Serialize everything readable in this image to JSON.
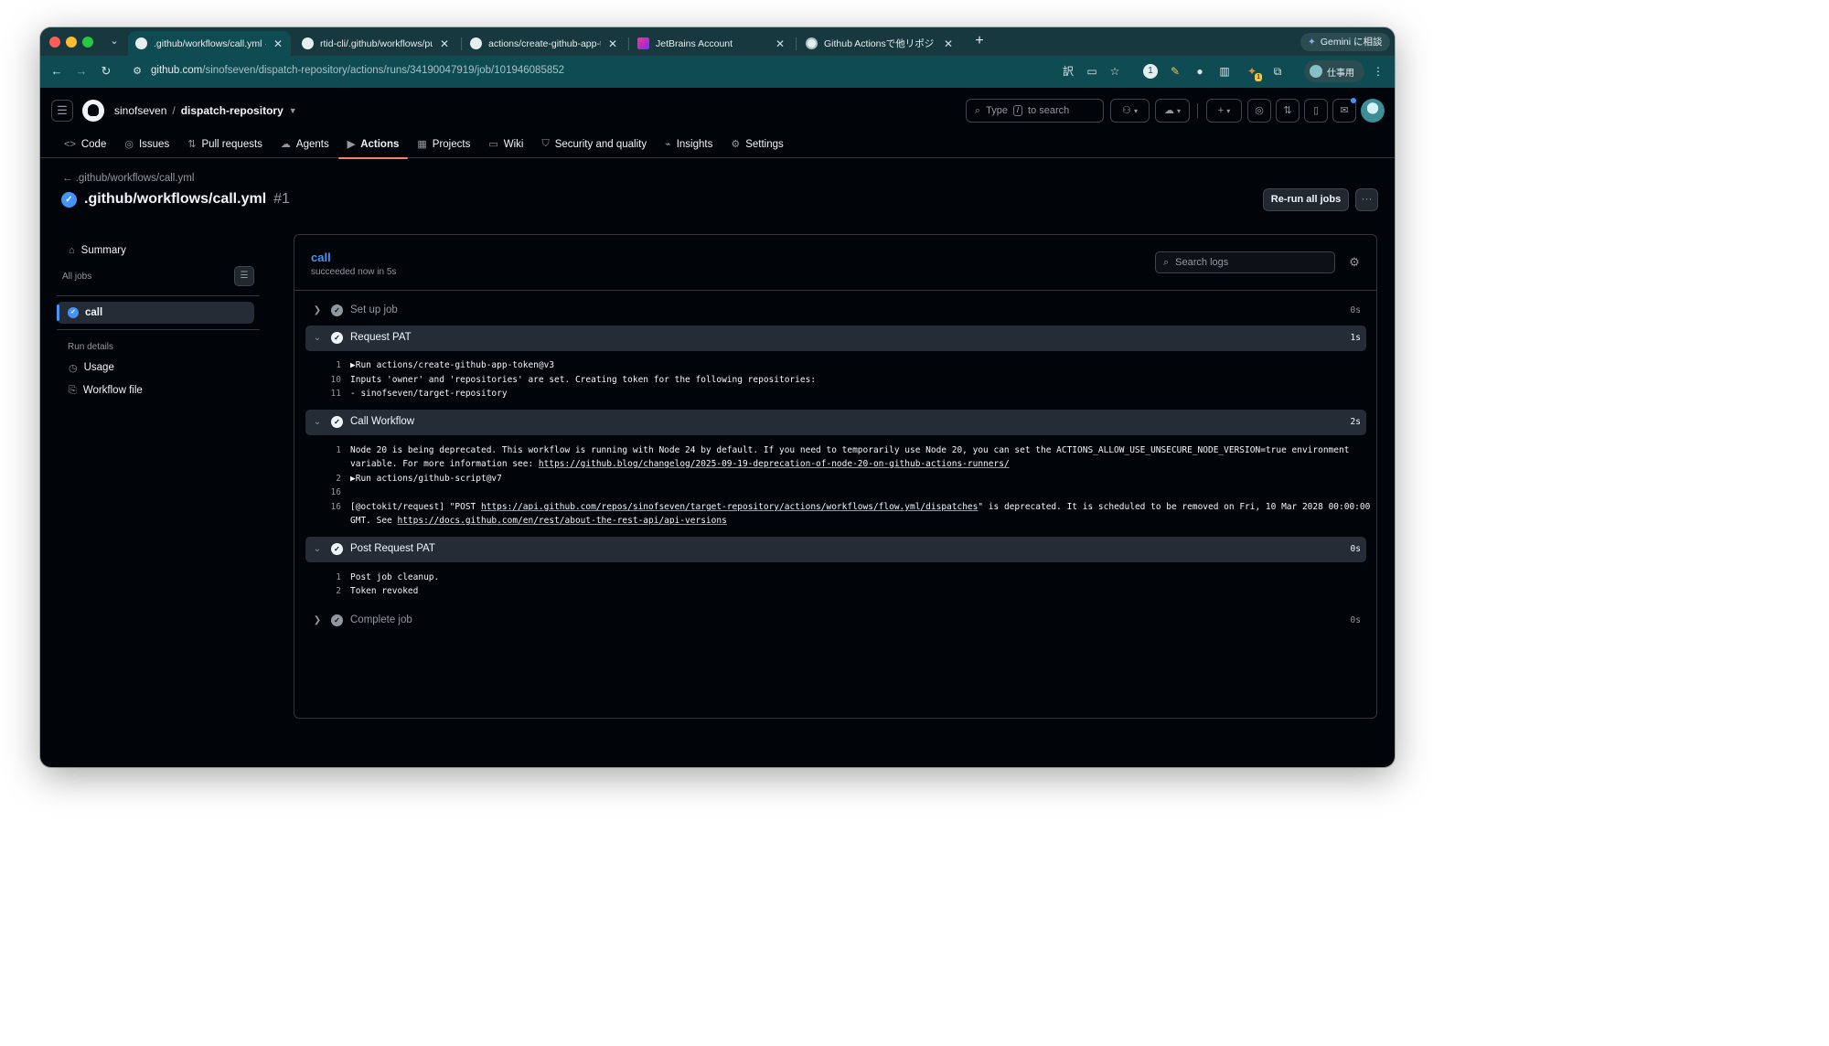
{
  "browser": {
    "tabs": [
      {
        "title": ".github/workflows/call.yml · si",
        "favicon": "github-icon",
        "active": true
      },
      {
        "title": "rtid-cli/.github/workflows/pub",
        "favicon": "github-icon",
        "active": false
      },
      {
        "title": "actions/create-github-app-to",
        "favicon": "github-icon",
        "active": false
      },
      {
        "title": "JetBrains Account",
        "favicon": "jetbrains-icon",
        "active": false
      },
      {
        "title": "Github Actionsで他リポジトリ",
        "favicon": "globe-icon",
        "active": false
      }
    ],
    "new_tab_label": "+",
    "gemini_label": "Gemini に相談",
    "url_host": "github.com",
    "url_path": "/sinofseven/dispatch-repository/actions/runs/34190047919/job/101946085852",
    "profile_label": "仕事用",
    "extension_badge": "1"
  },
  "header": {
    "owner": "sinofseven",
    "separator": "/",
    "repo": "dispatch-repository",
    "search_prefix": "Type",
    "search_key": "/",
    "search_suffix": "to search",
    "nav": [
      {
        "label": "Code",
        "icon": "code-icon"
      },
      {
        "label": "Issues",
        "icon": "issue-icon"
      },
      {
        "label": "Pull requests",
        "icon": "pull-request-icon"
      },
      {
        "label": "Agents",
        "icon": "agent-icon"
      },
      {
        "label": "Actions",
        "icon": "play-icon",
        "selected": true
      },
      {
        "label": "Projects",
        "icon": "table-icon"
      },
      {
        "label": "Wiki",
        "icon": "book-icon"
      },
      {
        "label": "Security and quality",
        "icon": "shield-icon"
      },
      {
        "label": "Insights",
        "icon": "graph-icon"
      },
      {
        "label": "Settings",
        "icon": "gear-icon"
      }
    ]
  },
  "run": {
    "back_link": ".github/workflows/call.yml",
    "title": ".github/workflows/call.yml",
    "number": "#1",
    "rerun_label": "Re-run all jobs",
    "more_label": "···"
  },
  "sidebar": {
    "summary_label": "Summary",
    "all_jobs_label": "All jobs",
    "job_label": "call",
    "run_details_label": "Run details",
    "usage_label": "Usage",
    "workflow_file_label": "Workflow file"
  },
  "log": {
    "job_name": "call",
    "status": "succeeded now in 5s",
    "search_placeholder": "Search logs",
    "steps": [
      {
        "name": "Set up job",
        "duration": "0s",
        "open": false,
        "lines": []
      },
      {
        "name": "Request PAT",
        "duration": "1s",
        "open": true,
        "lines": [
          {
            "n": "1",
            "text": "▶Run actions/create-github-app-token@v3"
          },
          {
            "n": "10",
            "text": "Inputs 'owner' and 'repositories' are set. Creating token for the following repositories:"
          },
          {
            "n": "11",
            "text": "- sinofseven/target-repository"
          }
        ]
      },
      {
        "name": "Call Workflow",
        "duration": "2s",
        "open": true,
        "lines": [
          {
            "n": "1",
            "text": "Node 20 is being deprecated. This workflow is running with Node 24 by default. If you need to temporarily use Node 20, you can set the ACTIONS_ALLOW_USE_UNSECURE_NODE_VERSION=true environment"
          },
          {
            "n": "",
            "text": "variable. For more information see: ",
            "link": "https://github.blog/changelog/2025-09-19-deprecation-of-node-20-on-github-actions-runners/"
          },
          {
            "n": "2",
            "text": "▶Run actions/github-script@v7"
          },
          {
            "n": "16",
            "text": ""
          },
          {
            "n": "16",
            "text": "[@octokit/request] \"POST ",
            "link": "https://api.github.com/repos/sinofseven/target-repository/actions/workflows/flow.yml/dispatches",
            "after": "\" is deprecated. It is scheduled to be removed on Fri, 10 Mar 2028 00:00:00"
          },
          {
            "n": "",
            "text": "GMT. See ",
            "link": "https://docs.github.com/en/rest/about-the-rest-api/api-versions"
          }
        ]
      },
      {
        "name": "Post Request PAT",
        "duration": "0s",
        "open": true,
        "lines": [
          {
            "n": "1",
            "text": "Post job cleanup."
          },
          {
            "n": "2",
            "text": "Token revoked"
          }
        ]
      },
      {
        "name": "Complete job",
        "duration": "0s",
        "open": false,
        "lines": []
      }
    ]
  }
}
